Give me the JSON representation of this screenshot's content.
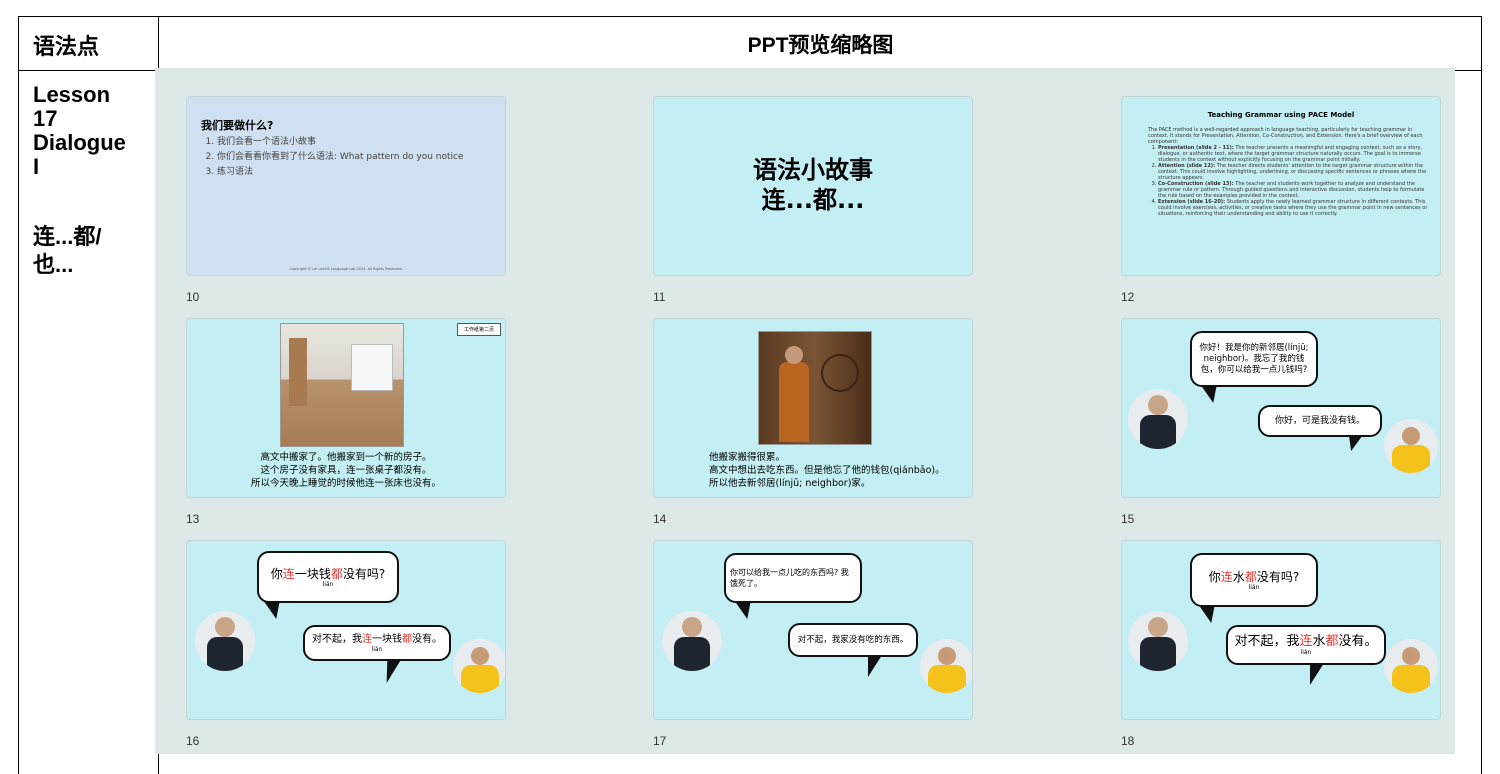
{
  "table": {
    "header_left": "语法点",
    "header_right": "PPT预览缩略图",
    "lesson": "Lesson\n17\nDialogue\nI",
    "grammar_point": "连...都/\n也..."
  },
  "slides": [
    {
      "num": "10",
      "title": "我们要做什么?",
      "items": [
        "我们会看一个语法小故事",
        "你们会看看你看到了什么语法: What pattern do you notice",
        "练习语法"
      ],
      "copyright": "Copyright © Lei Leveill Language Lab 2024. All Rights Reserved."
    },
    {
      "num": "11",
      "line1": "语法小故事",
      "line2": "连...都..."
    },
    {
      "num": "12",
      "title": "Teaching Grammar using PACE Model",
      "intro": "The PACE method is a well-regarded approach in language teaching, particularly for teaching grammar in context. It stands for Presentation, Attention, Co-Construction, and Extension. Here's a brief overview of each component:",
      "p1_head": "Presentation (slide 2 - 11):",
      "p1": "The teacher presents a meaningful and engaging context, such as a story, dialogue, or authentic text, where the target grammar structure naturally occurs. The goal is to immerse students in the context without explicitly focusing on the grammar point initially.",
      "p2_head": "Attention (slide 12):",
      "p2": "The teacher directs students' attention to the target grammar structure within the context. This could involve highlighting, underlining, or discussing specific sentences or phrases where the structure appears.",
      "p3_head": "Co-Construction (slide 13):",
      "p3": "The teacher and students work together to analyze and understand the grammar rule or pattern. Through guided questions and interactive discussion, students help to formulate the rule based on the examples provided in the context.",
      "p4_head": "Extension (slide 16-20):",
      "p4": "Students apply the newly learned grammar structure in different contexts. This could involve exercises, activities, or creative tasks where they use the grammar point in new sentences or situations, reinforcing their understanding and ability to use it correctly."
    },
    {
      "num": "13",
      "tag": "工作纸第二页",
      "l1": "高文中搬家了。他搬家到一个新的房子。",
      "l2": "这个房子没有家具，连一张桌子都没有。",
      "l3": "所以今天晚上睡觉的时候他连一张床也没有。"
    },
    {
      "num": "14",
      "l1": "他搬家搬得很累。",
      "l2": "高文中想出去吃东西。但是他忘了他的钱包(qiánbāo)。",
      "l3": "所以他去新邻居(línjū; neighbor)家。"
    },
    {
      "num": "15",
      "b1": "你好！我是你的新邻居(línjū; neighbor)。我忘了我的钱包，你可以给我一点儿钱吗?",
      "b2": "你好，可是我没有钱。"
    },
    {
      "num": "16",
      "b1_a": "你",
      "b1_red1": "连",
      "b1_b": "一块钱",
      "b1_red2": "都",
      "b1_c": "没有吗?",
      "b1_pin": "lián",
      "b2_a": "对不起，我",
      "b2_red1": "连",
      "b2_b": "一块钱",
      "b2_red2": "都",
      "b2_c": "没有。",
      "b2_pin": "lián"
    },
    {
      "num": "17",
      "b1": "你可以给我一点儿吃的东西吗? 我饿死了。",
      "b2": "对不起，我家没有吃的东西。"
    },
    {
      "num": "18",
      "b1_a": "你",
      "b1_red1": "连",
      "b1_b": "水",
      "b1_red2": "都",
      "b1_c": "没有吗?",
      "b1_pin": "lián",
      "b2_a": "对不起，我",
      "b2_red1": "连",
      "b2_b": "水",
      "b2_red2": "都",
      "b2_c": "没有。",
      "b2_pin": "lián"
    }
  ]
}
